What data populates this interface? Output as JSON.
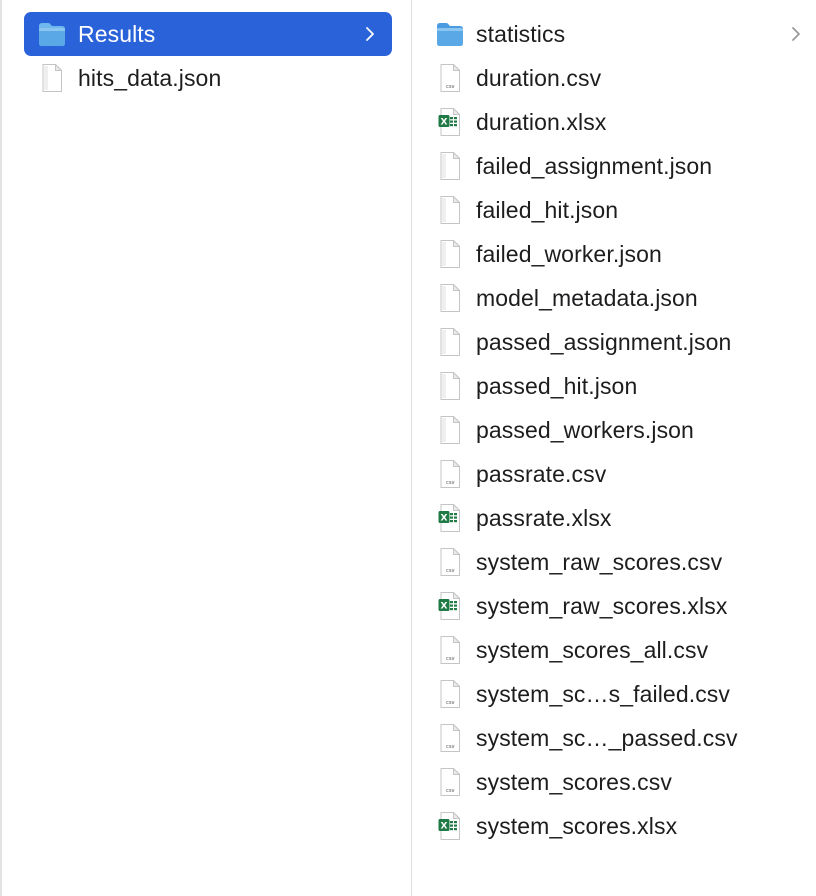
{
  "columns": [
    {
      "items": [
        {
          "label": "Results",
          "kind": "folder",
          "selected": true,
          "chevron": true
        },
        {
          "label": "hits_data.json",
          "kind": "json"
        }
      ]
    },
    {
      "items": [
        {
          "label": "statistics",
          "kind": "folder",
          "chevron": true
        },
        {
          "label": "duration.csv",
          "kind": "csv"
        },
        {
          "label": "duration.xlsx",
          "kind": "xlsx"
        },
        {
          "label": "failed_assignment.json",
          "kind": "json"
        },
        {
          "label": "failed_hit.json",
          "kind": "json"
        },
        {
          "label": "failed_worker.json",
          "kind": "json"
        },
        {
          "label": "model_metadata.json",
          "kind": "json"
        },
        {
          "label": "passed_assignment.json",
          "kind": "json"
        },
        {
          "label": "passed_hit.json",
          "kind": "json"
        },
        {
          "label": "passed_workers.json",
          "kind": "json"
        },
        {
          "label": "passrate.csv",
          "kind": "csv"
        },
        {
          "label": "passrate.xlsx",
          "kind": "xlsx"
        },
        {
          "label": "system_raw_scores.csv",
          "kind": "csv"
        },
        {
          "label": "system_raw_scores.xlsx",
          "kind": "xlsx"
        },
        {
          "label": "system_scores_all.csv",
          "kind": "csv"
        },
        {
          "label": "system_sc…s_failed.csv",
          "kind": "csv"
        },
        {
          "label": "system_sc…_passed.csv",
          "kind": "csv"
        },
        {
          "label": "system_scores.csv",
          "kind": "csv"
        },
        {
          "label": "system_scores.xlsx",
          "kind": "xlsx"
        }
      ]
    }
  ],
  "icons": {
    "folder": "folder-icon",
    "csv": "csv-file-icon",
    "xlsx": "excel-file-icon",
    "json": "json-file-icon",
    "chevron": "chevron-right-icon"
  },
  "icon_labels": {
    "csv": "csv",
    "xlsx": "X"
  },
  "colors": {
    "selection": "#2a63d9",
    "folder": "#5aa8e6",
    "excel": "#1f7a45"
  }
}
